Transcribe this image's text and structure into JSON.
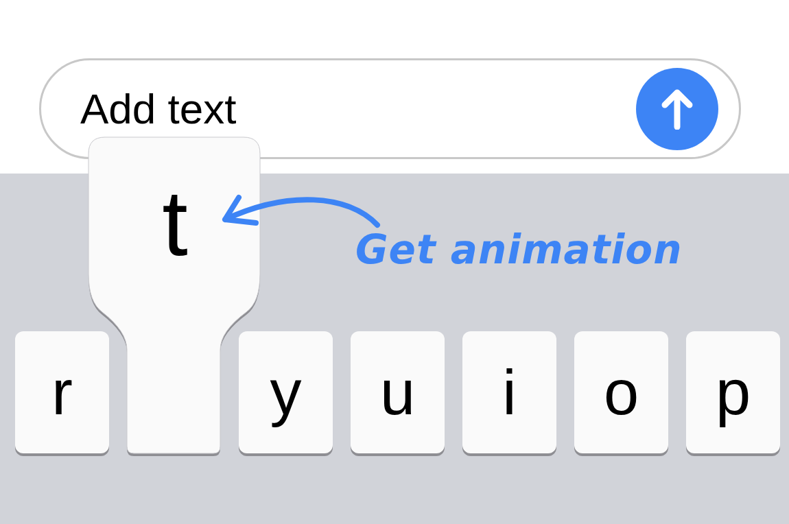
{
  "message_field": {
    "placeholder": "Add text"
  },
  "keys": [
    {
      "label": "r",
      "pressed": false
    },
    {
      "label": "t",
      "pressed": true
    },
    {
      "label": "y",
      "pressed": false
    },
    {
      "label": "u",
      "pressed": false
    },
    {
      "label": "i",
      "pressed": false
    },
    {
      "label": "o",
      "pressed": false
    },
    {
      "label": "p",
      "pressed": false
    }
  ],
  "annotation": "Get animation"
}
